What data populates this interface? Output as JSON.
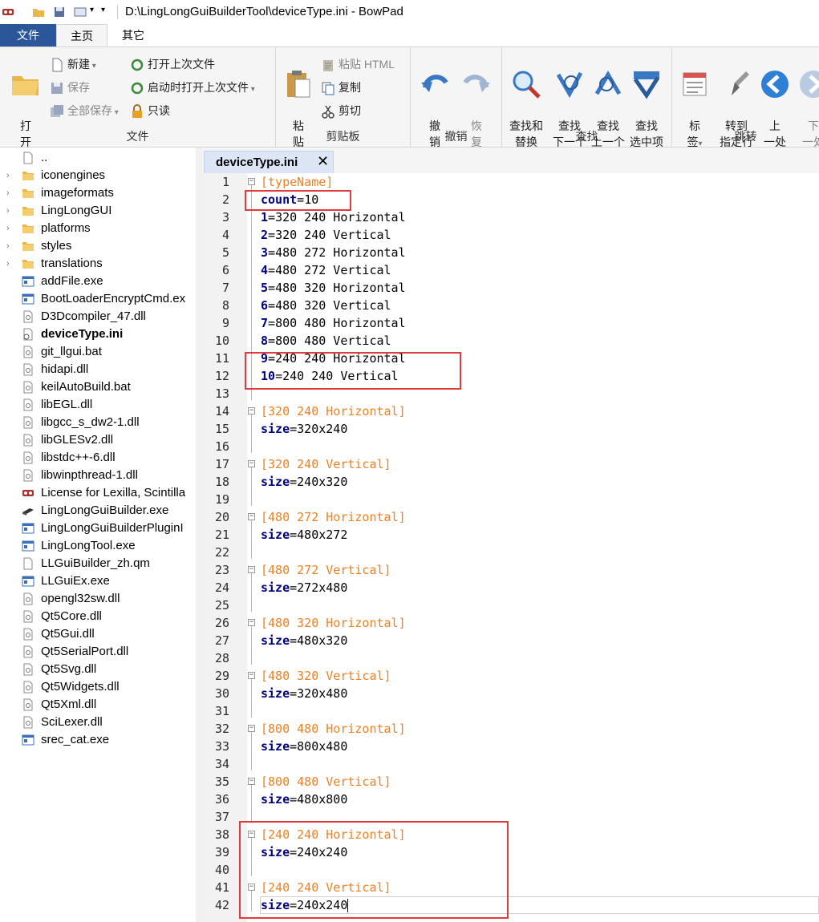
{
  "window": {
    "title": "D:\\LingLongGuiBuilderTool\\deviceType.ini - BowPad"
  },
  "menu_tabs": [
    "文件",
    "主页",
    "其它"
  ],
  "ribbon": {
    "file_group": {
      "label": "文件",
      "open": "打\n开",
      "new": "新建",
      "save": "保存",
      "save_all": "全部保存",
      "open_last": "打开上次文件",
      "open_last_startup": "启动时打开上次文件",
      "readonly": "只读"
    },
    "clipboard_group": {
      "label": "剪贴板",
      "paste": "粘\n贴",
      "paste_html": "粘贴 HTML",
      "copy": "复制",
      "cut": "剪切"
    },
    "undo_group": {
      "label": "撤销",
      "undo": "撤\n销",
      "redo": "恢\n复"
    },
    "find_group": {
      "label": "查找",
      "find_replace": "查找和\n替换",
      "find_next": "查找\n下一个",
      "find_prev": "查找\n上一个",
      "find_selected": "查找\n选中项"
    },
    "goto_group": {
      "label": "跳转",
      "bookmark": "标\n签",
      "goto_line": "转到\n指定行",
      "prev_pos": "上\n一处",
      "next_pos": "下\n一处"
    }
  },
  "file_tree": [
    {
      "name": "..",
      "type": "file-blank",
      "expandable": false
    },
    {
      "name": "iconengines",
      "type": "folder",
      "expandable": true
    },
    {
      "name": "imageformats",
      "type": "folder",
      "expandable": true
    },
    {
      "name": "LingLongGUI",
      "type": "folder",
      "expandable": true
    },
    {
      "name": "platforms",
      "type": "folder",
      "expandable": true
    },
    {
      "name": "styles",
      "type": "folder",
      "expandable": true
    },
    {
      "name": "translations",
      "type": "folder",
      "expandable": true
    },
    {
      "name": "addFile.exe",
      "type": "exe"
    },
    {
      "name": "BootLoaderEncryptCmd.ex",
      "type": "exe"
    },
    {
      "name": "D3Dcompiler_47.dll",
      "type": "dll"
    },
    {
      "name": "deviceType.ini",
      "type": "ini",
      "bold": true
    },
    {
      "name": "git_llgui.bat",
      "type": "dll"
    },
    {
      "name": "hidapi.dll",
      "type": "dll"
    },
    {
      "name": "keilAutoBuild.bat",
      "type": "dll"
    },
    {
      "name": "libEGL.dll",
      "type": "dll"
    },
    {
      "name": "libgcc_s_dw2-1.dll",
      "type": "dll"
    },
    {
      "name": "libGLESv2.dll",
      "type": "dll"
    },
    {
      "name": "libstdc++-6.dll",
      "type": "dll"
    },
    {
      "name": "libwinpthread-1.dll",
      "type": "dll"
    },
    {
      "name": "License for Lexilla, Scintilla",
      "type": "lic"
    },
    {
      "name": "LingLongGuiBuilder.exe",
      "type": "builder"
    },
    {
      "name": "LingLongGuiBuilderPluginI",
      "type": "exe"
    },
    {
      "name": "LingLongTool.exe",
      "type": "exe"
    },
    {
      "name": "LLGuiBuilder_zh.qm",
      "type": "file-blank"
    },
    {
      "name": "LLGuiEx.exe",
      "type": "exe"
    },
    {
      "name": "opengl32sw.dll",
      "type": "dll"
    },
    {
      "name": "Qt5Core.dll",
      "type": "dll"
    },
    {
      "name": "Qt5Gui.dll",
      "type": "dll"
    },
    {
      "name": "Qt5SerialPort.dll",
      "type": "dll"
    },
    {
      "name": "Qt5Svg.dll",
      "type": "dll"
    },
    {
      "name": "Qt5Widgets.dll",
      "type": "dll"
    },
    {
      "name": "Qt5Xml.dll",
      "type": "dll"
    },
    {
      "name": "SciLexer.dll",
      "type": "dll"
    },
    {
      "name": "srec_cat.exe",
      "type": "exe"
    }
  ],
  "editor": {
    "tab_label": "deviceType.ini",
    "tab_close": "✕",
    "lines": [
      {
        "n": "1",
        "kind": "section",
        "text": "[typeName]",
        "fold": "minus"
      },
      {
        "n": "2",
        "kind": "kv",
        "key": "count",
        "val": "10"
      },
      {
        "n": "3",
        "kind": "kv",
        "key": "1",
        "val": "320 240 Horizontal"
      },
      {
        "n": "4",
        "kind": "kv",
        "key": "2",
        "val": "320 240 Vertical"
      },
      {
        "n": "5",
        "kind": "kv",
        "key": "3",
        "val": "480 272 Horizontal"
      },
      {
        "n": "6",
        "kind": "kv",
        "key": "4",
        "val": "480 272 Vertical"
      },
      {
        "n": "7",
        "kind": "kv",
        "key": "5",
        "val": "480 320 Horizontal"
      },
      {
        "n": "8",
        "kind": "kv",
        "key": "6",
        "val": "480 320 Vertical"
      },
      {
        "n": "9",
        "kind": "kv",
        "key": "7",
        "val": "800 480 Horizontal"
      },
      {
        "n": "10",
        "kind": "kv",
        "key": "8",
        "val": "800 480 Vertical"
      },
      {
        "n": "11",
        "kind": "kv",
        "key": "9",
        "val": "240 240 Horizontal"
      },
      {
        "n": "12",
        "kind": "kv",
        "key": "10",
        "val": "240 240 Vertical"
      },
      {
        "n": "13",
        "kind": "blank"
      },
      {
        "n": "14",
        "kind": "section",
        "text": "[320 240 Horizontal]",
        "fold": "minus"
      },
      {
        "n": "15",
        "kind": "kv",
        "key": "size",
        "val": "320x240"
      },
      {
        "n": "16",
        "kind": "blank"
      },
      {
        "n": "17",
        "kind": "section",
        "text": "[320 240 Vertical]",
        "fold": "minus"
      },
      {
        "n": "18",
        "kind": "kv",
        "key": "size",
        "val": "240x320"
      },
      {
        "n": "19",
        "kind": "blank"
      },
      {
        "n": "20",
        "kind": "section",
        "text": "[480 272 Horizontal]",
        "fold": "minus"
      },
      {
        "n": "21",
        "kind": "kv",
        "key": "size",
        "val": "480x272"
      },
      {
        "n": "22",
        "kind": "blank"
      },
      {
        "n": "23",
        "kind": "section",
        "text": "[480 272 Vertical]",
        "fold": "minus"
      },
      {
        "n": "24",
        "kind": "kv",
        "key": "size",
        "val": "272x480"
      },
      {
        "n": "25",
        "kind": "blank"
      },
      {
        "n": "26",
        "kind": "section",
        "text": "[480 320 Horizontal]",
        "fold": "minus"
      },
      {
        "n": "27",
        "kind": "kv",
        "key": "size",
        "val": "480x320"
      },
      {
        "n": "28",
        "kind": "blank"
      },
      {
        "n": "29",
        "kind": "section",
        "text": "[480 320 Vertical]",
        "fold": "minus"
      },
      {
        "n": "30",
        "kind": "kv",
        "key": "size",
        "val": "320x480"
      },
      {
        "n": "31",
        "kind": "blank"
      },
      {
        "n": "32",
        "kind": "section",
        "text": "[800 480 Horizontal]",
        "fold": "minus"
      },
      {
        "n": "33",
        "kind": "kv",
        "key": "size",
        "val": "800x480"
      },
      {
        "n": "34",
        "kind": "blank"
      },
      {
        "n": "35",
        "kind": "section",
        "text": "[800 480 Vertical]",
        "fold": "minus"
      },
      {
        "n": "36",
        "kind": "kv",
        "key": "size",
        "val": "480x800"
      },
      {
        "n": "37",
        "kind": "blank"
      },
      {
        "n": "38",
        "kind": "section",
        "text": "[240 240 Horizontal]",
        "fold": "minus"
      },
      {
        "n": "39",
        "kind": "kv",
        "key": "size",
        "val": "240x240"
      },
      {
        "n": "40",
        "kind": "blank"
      },
      {
        "n": "41",
        "kind": "section",
        "text": "[240 240 Vertical]",
        "fold": "minus"
      },
      {
        "n": "42",
        "kind": "kv",
        "key": "size",
        "val": "240x240",
        "caret": true
      }
    ]
  },
  "colors": {
    "key": "#00007f",
    "section": "#f08020",
    "accent": "#2b579a",
    "highlight_box": "#e03c3c"
  }
}
